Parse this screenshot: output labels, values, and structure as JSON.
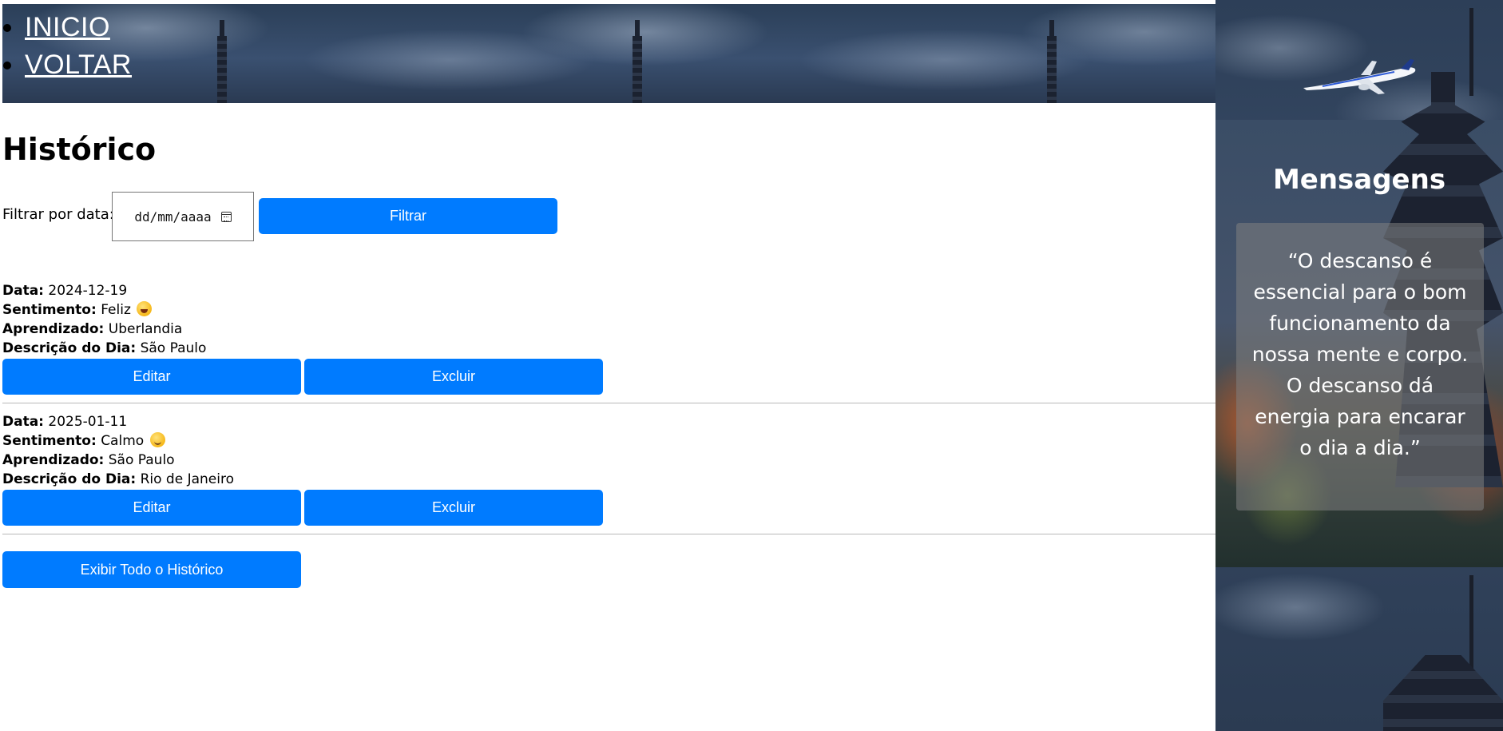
{
  "nav": {
    "items": [
      {
        "label": "INICIO"
      },
      {
        "label": "VOLTAR"
      }
    ]
  },
  "page": {
    "title": "Histórico"
  },
  "filter": {
    "label": "Filtrar por data:",
    "date_placeholder": "dd/mm/aaaa",
    "button_label": "Filtrar"
  },
  "labels": {
    "data": "Data:",
    "sentimento": "Sentimento:",
    "aprendizado": "Aprendizado:",
    "descricao": "Descrição do Dia:"
  },
  "entries": [
    {
      "data": "2024-12-19",
      "sentimento": "Feliz",
      "sentimento_emoji": "grinning-face-icon",
      "aprendizado": "Uberlandia",
      "descricao": "São Paulo",
      "edit_label": "Editar",
      "delete_label": "Excluir"
    },
    {
      "data": "2025-01-11",
      "sentimento": "Calmo",
      "sentimento_emoji": "relieved-face-icon",
      "aprendizado": "São Paulo",
      "descricao": "Rio de Janeiro",
      "edit_label": "Editar",
      "delete_label": "Excluir"
    }
  ],
  "show_all": {
    "label": "Exibir Todo o Histórico"
  },
  "sidebar": {
    "title": "Mensagens",
    "quote": "“O descanso é essencial para o bom funcionamento da nossa mente e corpo. O descanso dá energia para encarar o dia a dia.”",
    "image_icon": "airplane-icon"
  },
  "colors": {
    "button": "#007bff",
    "button_text": "#ffffff",
    "divider": "#b8b8b8"
  }
}
